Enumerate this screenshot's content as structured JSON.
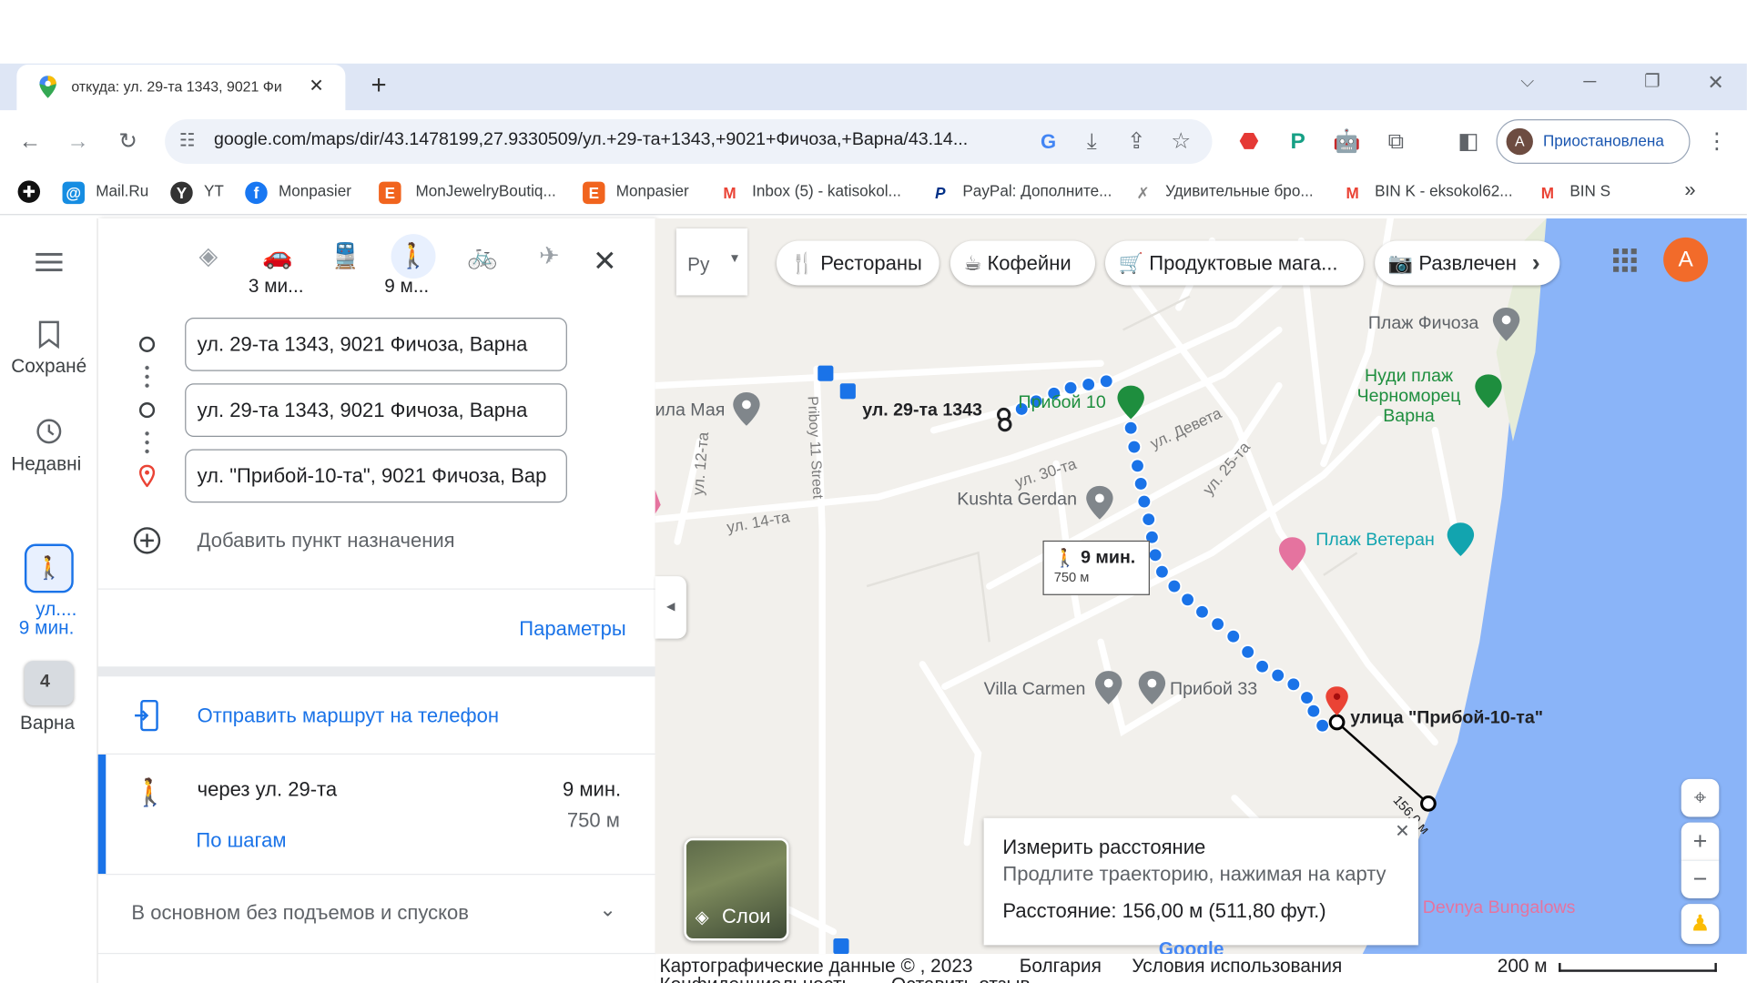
{
  "browser": {
    "tab_title": "откуда: ул. 29-та 1343, 9021 Фи",
    "url": "google.com/maps/dir/43.1478199,27.9330509/ул.+29-та+1343,+9021+Фичоза,+Варна/43.14...",
    "profile_label": "Приостановлена",
    "profile_initial": "A",
    "bookmarks": [
      "Mail.Ru",
      "YT",
      "Monpasier",
      "MonJewelryBoutiq...",
      "Monpasier",
      "Inbox (5) - katisokol...",
      "PayPal: Дополните...",
      "Удивительные бро...",
      "BIN K - eksokol62...",
      "BIN S"
    ],
    "bookmarks_overflow": "»"
  },
  "rail": {
    "saved_label": "Сохранé",
    "recent_label": "Недавні",
    "recent_route_label": "ул....",
    "recent_route_time": "9 мин.",
    "varna_label": "Варна",
    "varna_badge": "4"
  },
  "directions": {
    "modes": [
      {
        "name": "best",
        "time": ""
      },
      {
        "name": "car",
        "time": "3 ми..."
      },
      {
        "name": "transit",
        "time": ""
      },
      {
        "name": "walk",
        "time": "9 м..."
      },
      {
        "name": "bike",
        "time": ""
      },
      {
        "name": "flight",
        "time": ""
      }
    ],
    "waypoints": [
      "ул. 29-та 1343, 9021 Фичоза, Варна",
      "ул. 29-та 1343, 9021 Фичоза, Варна",
      "ул. \"Прибой-10-та\", 9021 Фичоза, Вар"
    ],
    "add_destination": "Добавить пункт назначения",
    "params": "Параметры",
    "send_to_phone": "Отправить маршрут на телефон",
    "route": {
      "via": "через ул. 29-та",
      "duration": "9 мин.",
      "distance": "750 м",
      "steps": "По шагам"
    },
    "elevation": "В основном без подъемов и спусков"
  },
  "map": {
    "language_button": "Ру",
    "chips": [
      "Рестораны",
      "Кофейни",
      "Продуктовые мага...",
      "Развлечен"
    ],
    "user_initial": "A",
    "labels": {
      "start": "ул. 29-та 1343",
      "priboi10": "Прибой 10",
      "kushta": "Kushta Gerdan",
      "villa": "Villa Carmen",
      "priboi33": "Прибой 33",
      "beach_fichoza": "Плаж Фичоза",
      "nudi": "Нуди плаж\nЧерноморец\nВарна",
      "veteran": "Плаж Ветеран",
      "end": "улица \"Прибой-10-та\"",
      "vila_maya": "ила Мая",
      "devnya": "Devnya Bungalows",
      "google": "Google"
    },
    "streets": [
      "ул. 30-та",
      "ул. Девета",
      "ул. 25-та",
      "ул. 14-та",
      "ул. 12-та",
      "Priboy 11 Street",
      "156,0 м"
    ],
    "walk_tooltip": {
      "time": "9 мин.",
      "distance": "750 м"
    },
    "layers_label": "Слои",
    "measure": {
      "title": "Измерить расстояние",
      "hint": "Продлите траекторию, нажимая на карту",
      "distance": "Расстояние: 156,00 м (511,80 фут.)"
    },
    "footer": {
      "copyright": "Картографические данные © , 2023",
      "country": "Болгария",
      "terms": "Условия использования",
      "privacy": "Конфиденциальность",
      "feedback": "Оставить отзыв",
      "scale": "200 м"
    }
  },
  "colors": {
    "route_blue": "#1a73e8",
    "water": "#8ab4f8",
    "accent_blue": "#1a73e8",
    "avatar_orange": "#f26b2a",
    "poi_green": "#1e8e3e",
    "poi_teal": "#12a4af",
    "poi_pink": "#e5739f",
    "pin_red": "#ea4335"
  }
}
